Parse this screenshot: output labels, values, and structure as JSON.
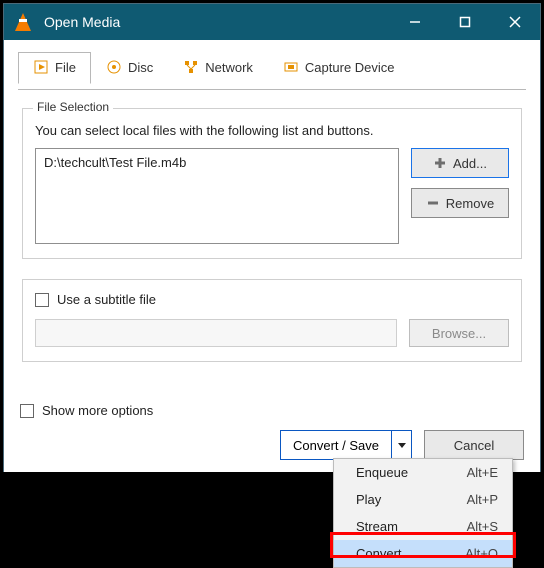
{
  "window": {
    "title": "Open Media"
  },
  "tabs": {
    "file": "File",
    "disc": "Disc",
    "network": "Network",
    "capture": "Capture Device"
  },
  "file_selection": {
    "legend": "File Selection",
    "note": "You can select local files with the following list and buttons.",
    "items": [
      "D:\\techcult\\Test File.m4b"
    ],
    "add": "Add...",
    "remove": "Remove"
  },
  "subtitle": {
    "checkbox": "Use a subtitle file",
    "browse": "Browse..."
  },
  "footer": {
    "show_more": "Show more options",
    "convert_save": "Convert / Save",
    "cancel": "Cancel"
  },
  "menu": {
    "items": [
      {
        "label": "Enqueue",
        "shortcut": "Alt+E"
      },
      {
        "label": "Play",
        "shortcut": "Alt+P"
      },
      {
        "label": "Stream",
        "shortcut": "Alt+S"
      },
      {
        "label": "Convert",
        "shortcut": "Alt+O"
      }
    ],
    "highlight_index": 3
  }
}
